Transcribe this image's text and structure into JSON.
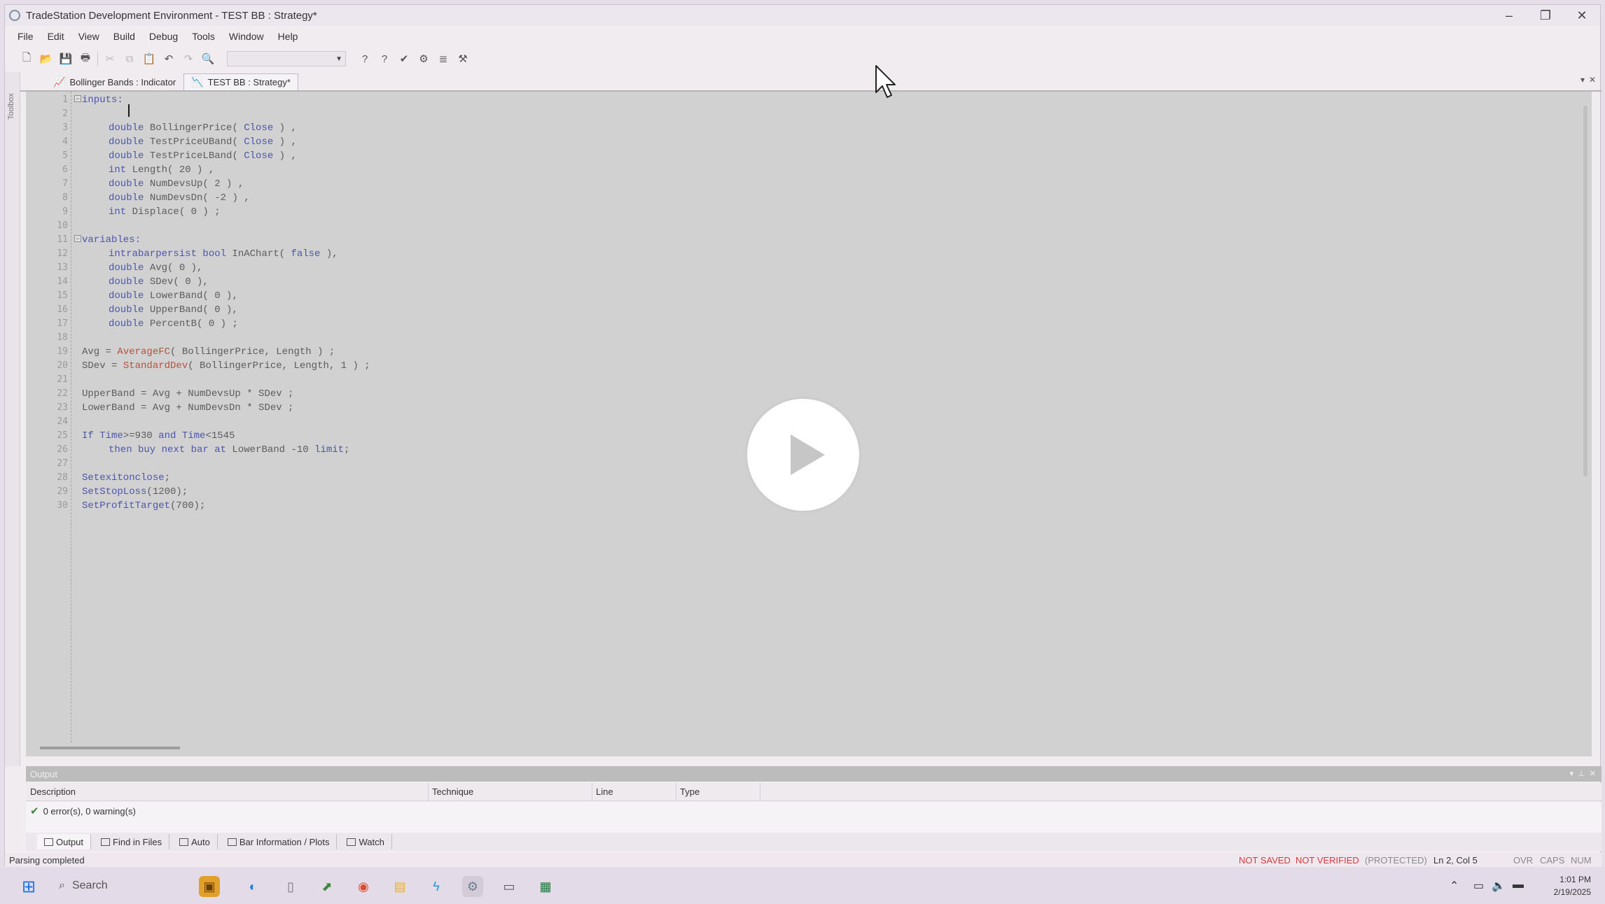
{
  "window": {
    "title": "TradeStation Development Environment - TEST BB : Strategy*",
    "minimize": "–",
    "restore": "❐",
    "close": "✕"
  },
  "menu": [
    "File",
    "Edit",
    "View",
    "Build",
    "Debug",
    "Tools",
    "Window",
    "Help"
  ],
  "toolbox_label": "Toolbox",
  "doc_tabs": [
    {
      "label": "Bollinger Bands : Indicator",
      "active": false
    },
    {
      "label": "TEST BB : Strategy*",
      "active": true
    }
  ],
  "tab_controls": {
    "dropdown": "▾",
    "close": "✕"
  },
  "editor": {
    "line_numbers": [
      "1",
      "2",
      "3",
      "4",
      "5",
      "6",
      "7",
      "8",
      "9",
      "10",
      "11",
      "12",
      "13",
      "14",
      "15",
      "16",
      "17",
      "18",
      "19",
      "20",
      "21",
      "22",
      "23",
      "24",
      "25",
      "26",
      "27",
      "28",
      "29",
      "30"
    ],
    "fold_markers": {
      "collapse": "−"
    },
    "lines": {
      "l1": {
        "kw": "inputs:"
      },
      "l3": {
        "kw": "double",
        "rest": " BollingerPrice( ",
        "kw2": "Close",
        "rest2": " ) ,"
      },
      "l4": {
        "kw": "double",
        "rest": " TestPriceUBand( ",
        "kw2": "Close",
        "rest2": " ) ,"
      },
      "l5": {
        "kw": "double",
        "rest": " TestPriceLBand( ",
        "kw2": "Close",
        "rest2": " ) ,"
      },
      "l6": {
        "kw": "int",
        "rest": " Length( 20 ) ,"
      },
      "l7": {
        "kw": "double",
        "rest": " NumDevsUp( 2 ) ,"
      },
      "l8": {
        "kw": "double",
        "rest": " NumDevsDn( -2 ) ,"
      },
      "l9": {
        "kw": "int",
        "rest": " Displace( 0 ) ;"
      },
      "l11": {
        "kw": "variables:"
      },
      "l12": {
        "kw": "intrabarpersist bool",
        "rest": " InAChart( ",
        "kw2": "false",
        "rest2": " ),"
      },
      "l13": {
        "kw": "double",
        "rest": " Avg( 0 ),"
      },
      "l14": {
        "kw": "double",
        "rest": " SDev( 0 ),"
      },
      "l15": {
        "kw": "double",
        "rest": " LowerBand( 0 ),"
      },
      "l16": {
        "kw": "double",
        "rest": " UpperBand( 0 ),"
      },
      "l17": {
        "kw": "double",
        "rest": " PercentB( 0 ) ;"
      },
      "l19": {
        "pre": "Avg = ",
        "fn": "AverageFC",
        "rest": "( BollingerPrice, Length ) ;"
      },
      "l20": {
        "pre": "SDev = ",
        "fn": "StandardDev",
        "rest": "( BollingerPrice, Length, 1 ) ;"
      },
      "l22": {
        "text": "UpperBand = Avg + NumDevsUp * SDev ;"
      },
      "l23": {
        "text": "LowerBand = Avg + NumDevsDn * SDev ;"
      },
      "l25": {
        "kw": "If Time",
        "rest": ">=930 ",
        "kw2": "and Time",
        "rest2": "<1545"
      },
      "l26": {
        "kw": "then buy next bar at",
        "rest": " LowerBand -10 ",
        "kw2": "limit",
        "rest2": ";"
      },
      "l28": {
        "kw": "Setexitonclose",
        "rest": ";"
      },
      "l29": {
        "kw": "SetStopLoss",
        "rest": "(1200);"
      },
      "l30": {
        "kw": "SetProfitTarget",
        "rest": "(700);"
      }
    }
  },
  "output": {
    "title": "Output",
    "controls": {
      "dropdown": "▾",
      "pin": "⊥",
      "close": "✕"
    },
    "columns": [
      "Description",
      "Technique",
      "Line",
      "Type"
    ],
    "rows": [
      "0 error(s), 0 warning(s)"
    ],
    "tabs": [
      "Output",
      "Find in Files",
      "Auto",
      "Bar Information / Plots",
      "Watch"
    ]
  },
  "status": {
    "message": "Parsing completed",
    "not_saved": "NOT SAVED",
    "not_verified": "NOT VERIFIED",
    "protected": "(PROTECTED)",
    "position": "Ln 2, Col 5",
    "ovr": "OVR",
    "caps": "CAPS",
    "num": "NUM"
  },
  "taskbar": {
    "search_placeholder": "Search",
    "time": "1:01 PM",
    "date": "2/19/2025"
  },
  "colors": {
    "keyword": "#4d54a9",
    "function": "#b4513f",
    "error_status": "#d43c3c",
    "editor_bg": "#d1d1d1"
  }
}
